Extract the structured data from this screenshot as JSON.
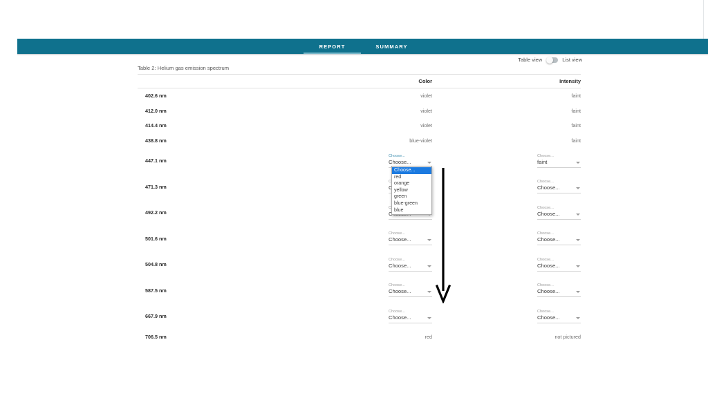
{
  "window": {
    "background": "#ffffff",
    "accent_teal": "#0f718d",
    "accent_underline": "#77b7c9",
    "highlight_blue": "#1b7ae0",
    "intensity_text_color": "#8a6a3c"
  },
  "navbar": {
    "tabs": [
      {
        "label": "REPORT",
        "active": true
      },
      {
        "label": "SUMMARY",
        "active": false
      }
    ]
  },
  "view_toggle": {
    "left_label": "Table view",
    "right_label": "List view",
    "state": "table"
  },
  "table": {
    "caption": "Table 2: Helium gas emission spectrum",
    "columns": {
      "wavelength": "",
      "color": "Color",
      "intensity": "Intensity"
    },
    "rows": [
      {
        "wavelength": "402.6 nm",
        "color_kind": "text",
        "color": "violet",
        "intensity_kind": "text",
        "intensity": "faint"
      },
      {
        "wavelength": "412.0 nm",
        "color_kind": "text",
        "color": "violet",
        "intensity_kind": "text",
        "intensity": "faint"
      },
      {
        "wavelength": "414.4 nm",
        "color_kind": "text",
        "color": "violet",
        "intensity_kind": "text",
        "intensity": "faint"
      },
      {
        "wavelength": "438.8 nm",
        "color_kind": "text",
        "color": "blue-violet",
        "intensity_kind": "text",
        "intensity": "faint"
      },
      {
        "wavelength": "447.1 nm",
        "color_kind": "select",
        "color": "Choose...",
        "color_label": "Choose...",
        "color_open": true,
        "intensity_kind": "select",
        "intensity": "faint",
        "intensity_label": "Choose..."
      },
      {
        "wavelength": "471.3 nm",
        "color_kind": "select",
        "color": "Choose...",
        "color_label": "Choose...",
        "intensity_kind": "select",
        "intensity": "Choose...",
        "intensity_label": "Choose..."
      },
      {
        "wavelength": "492.2 nm",
        "color_kind": "select",
        "color": "Choose...",
        "color_label": "Choose...",
        "intensity_kind": "select",
        "intensity": "Choose...",
        "intensity_label": "Choose..."
      },
      {
        "wavelength": "501.6 nm",
        "color_kind": "select",
        "color": "Choose...",
        "color_label": "Choose...",
        "intensity_kind": "select",
        "intensity": "Choose...",
        "intensity_label": "Choose..."
      },
      {
        "wavelength": "504.8 nm",
        "color_kind": "select",
        "color": "Choose...",
        "color_label": "Choose...",
        "intensity_kind": "select",
        "intensity": "Choose...",
        "intensity_label": "Choose..."
      },
      {
        "wavelength": "587.5 nm",
        "color_kind": "select",
        "color": "Choose...",
        "color_label": "Choose...",
        "intensity_kind": "select",
        "intensity": "Choose...",
        "intensity_label": "Choose..."
      },
      {
        "wavelength": "667.9 nm",
        "color_kind": "select",
        "color": "Choose...",
        "color_label": "Choose...",
        "intensity_kind": "select",
        "intensity": "Choose...",
        "intensity_label": "Choose..."
      },
      {
        "wavelength": "706.5 nm",
        "color_kind": "text",
        "color": "red",
        "intensity_kind": "text_plain",
        "intensity": "not pictured"
      }
    ]
  },
  "open_dropdown": {
    "belongs_to_row": "447.1 nm",
    "column": "Color",
    "options": [
      {
        "label": "Choose...",
        "selected": true
      },
      {
        "label": "red",
        "selected": false
      },
      {
        "label": "orange",
        "selected": false
      },
      {
        "label": "yellow",
        "selected": false
      },
      {
        "label": "green",
        "selected": false
      },
      {
        "label": "blue-green",
        "selected": false
      },
      {
        "label": "blue",
        "selected": false
      }
    ]
  },
  "annotation": {
    "type": "down-arrow",
    "color": "#000000"
  }
}
